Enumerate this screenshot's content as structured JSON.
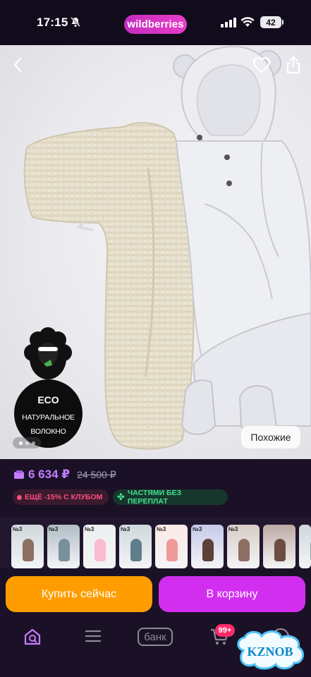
{
  "status_bar": {
    "time": "17:15",
    "battery": "42"
  },
  "app": {
    "brand": "wildberries"
  },
  "product": {
    "eco_badge": {
      "title": "ECO",
      "line1": "НАТУРАЛЬНОЕ",
      "line2": "ВОЛОКНО"
    },
    "similar_label": "Похожие",
    "price": "6 634 ₽",
    "old_price": "24 500 ₽",
    "club_badge": "ЕЩЁ -15% С КЛУБОМ",
    "installment_badge": "ЧАСТЯМИ БЕЗ ПЕРЕПЛАТ"
  },
  "thumbnails": [
    {
      "tag": "№3"
    },
    {
      "tag": "№3"
    },
    {
      "tag": "№3"
    },
    {
      "tag": "№3"
    },
    {
      "tag": "№3"
    },
    {
      "tag": "№3"
    },
    {
      "tag": "№3"
    },
    {
      "tag": ""
    },
    {
      "tag": ""
    }
  ],
  "actions": {
    "buy_now": "Купить сейчас",
    "add_to_cart": "В корзину"
  },
  "tabbar": {
    "bank": "банк",
    "cart_count": "99+"
  },
  "watermark": "KZNOB",
  "colors": {
    "accent": "#c67dff",
    "buy": "#ff9d00",
    "cart": "#d22ef0",
    "club": "#ff4e84",
    "parts": "#43e08f"
  }
}
